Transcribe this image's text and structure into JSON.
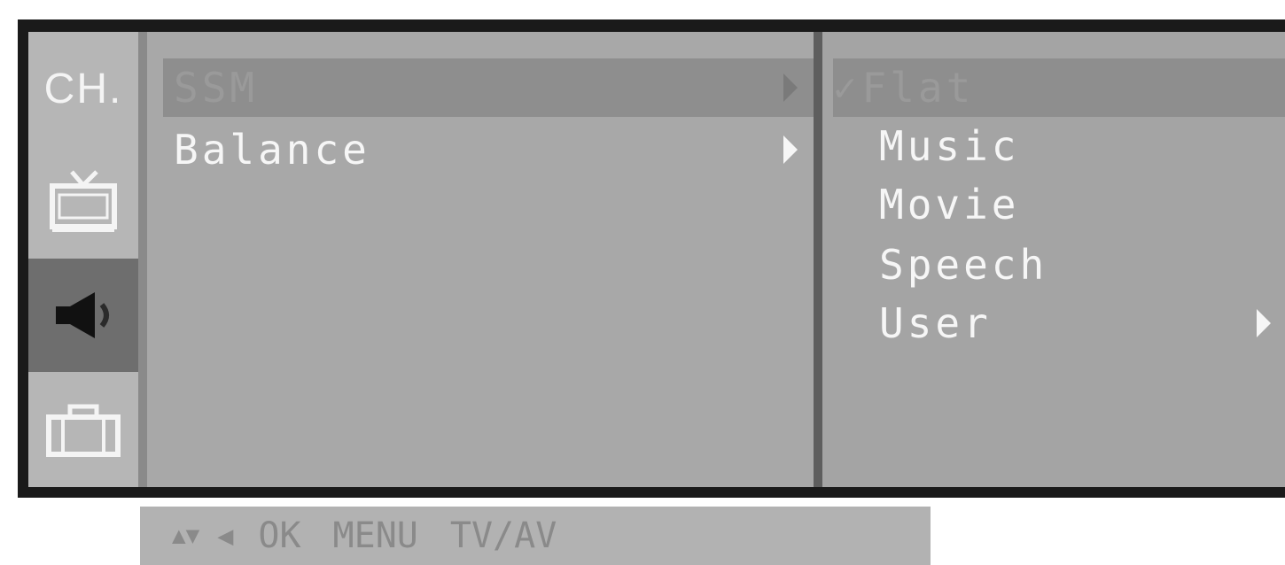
{
  "sidebar": {
    "items": [
      {
        "label": "CH.",
        "icon": "channel-text"
      },
      {
        "label": "",
        "icon": "tv-icon"
      },
      {
        "label": "",
        "icon": "speaker-icon",
        "active": true
      },
      {
        "label": "",
        "icon": "briefcase-icon"
      }
    ]
  },
  "menu": {
    "items": [
      {
        "label": "SSM",
        "highlighted": true
      },
      {
        "label": "Balance",
        "highlighted": false
      }
    ]
  },
  "submenu": {
    "check_mark": "✓",
    "items": [
      {
        "label": "Flat",
        "selected": true
      },
      {
        "label": "Music"
      },
      {
        "label": "Movie"
      },
      {
        "label": "Speech"
      },
      {
        "label": "User",
        "has_submenu": true
      }
    ]
  },
  "help_bar": {
    "nav_glyph": "▲▼",
    "left_glyph": "◀",
    "ok": "OK",
    "menu": "MENU",
    "tvav": "TV/AV"
  }
}
